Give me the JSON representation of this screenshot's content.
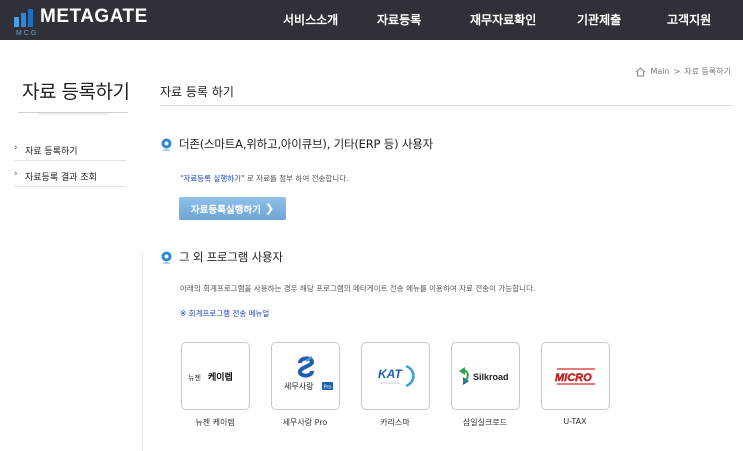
{
  "header": {
    "logo_text": "METAGATE",
    "logo_sub": "MCG",
    "nav": [
      "서비스소개",
      "자료등록",
      "재무자료확인",
      "기관제출",
      "고객지원"
    ]
  },
  "sidebar": {
    "title": "자료 등록하기",
    "items": [
      {
        "label": "자료 등록하기"
      },
      {
        "label": "자료등록 결과 조회"
      }
    ]
  },
  "breadcrumb": {
    "home": "Main",
    "sep": ">",
    "current": "자료 등록하기"
  },
  "main": {
    "title": "자료 등록 하기",
    "section1": {
      "heading": "더존(스마트A,위하고,아이큐브), 기타(ERP 등) 사용자",
      "note_highlight": "\"자료등록 실행하기\"",
      "note_rest": " 로 자료를 첨부 하여 전송합니다.",
      "button_label": "자료등록실행하기",
      "button_chevron": "❯"
    },
    "section2": {
      "heading": "그 외 프로그램 사용자",
      "note": "아래의 회계프로그램을 사용하는 경우 해당 프로그램의 메타게이트 전송 메뉴를 이용하여 자료 전송이 가능합니다.",
      "manual_link": "※ 회계프로그램 전송 메뉴얼"
    },
    "programs": [
      {
        "label": "뉴젠 케이렙",
        "logo_text": "뉴젠",
        "logo_text2": "케이렙"
      },
      {
        "label": "세무사랑 Pro",
        "logo_text": "세무사랑",
        "logo_badge": "Pro"
      },
      {
        "label": "카리스마",
        "logo_text": "KAT"
      },
      {
        "label": "삼일실크로드",
        "logo_text": "Silkroad"
      },
      {
        "label": "U-TAX",
        "logo_text": "MICRO"
      }
    ]
  },
  "colors": {
    "header_bg": "#303038",
    "accent_blue": "#2f86d6",
    "button_bg": "#7fb3df",
    "link_blue": "#1a3fc2",
    "micro_red": "#d42b2b"
  }
}
